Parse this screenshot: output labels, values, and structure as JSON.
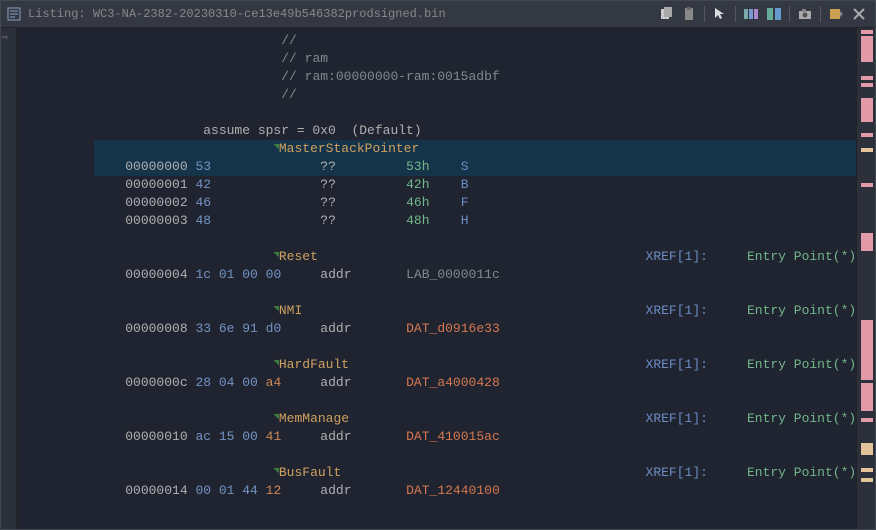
{
  "titlebar": {
    "prefix": "Listing: ",
    "filename": "WC3-NA-2382-20230310-ce13e49b546382prodsigned.bin"
  },
  "comments": {
    "c1": "//",
    "c2": "// ram",
    "c3": "// ram:00000000-ram:0015adbf",
    "c4": "//"
  },
  "assume": "assume spsr = 0x0  (Default)",
  "labels": {
    "msp": "MasterStackPointer",
    "reset": "Reset",
    "nmi": "NMI",
    "hard": "HardFault",
    "mem": "MemManage",
    "bus": "BusFault"
  },
  "rows": {
    "r0": {
      "addr": "00000000",
      "bytes": "53",
      "mnem": "??",
      "hex": "53h",
      "asc": "S"
    },
    "r1": {
      "addr": "00000001",
      "bytes": "42",
      "mnem": "??",
      "hex": "42h",
      "asc": "B"
    },
    "r2": {
      "addr": "00000002",
      "bytes": "46",
      "mnem": "??",
      "hex": "46h",
      "asc": "F"
    },
    "r3": {
      "addr": "00000003",
      "bytes": "48",
      "mnem": "??",
      "hex": "48h",
      "asc": "H"
    },
    "r4": {
      "addr": "00000004",
      "bytes": "1c 01 00 00",
      "mnem": "addr",
      "ref": "LAB_0000011c"
    },
    "r5": {
      "addr": "00000008",
      "bytes": "33 6e 91 d0",
      "mnem": "addr",
      "ref": "DAT_d0916e33"
    },
    "r6": {
      "addr": "0000000c",
      "bytes": "28 04 00 a4",
      "lastbyte": "a4",
      "mnem": "addr",
      "ref": "DAT_a4000428"
    },
    "r7": {
      "addr": "00000010",
      "bytes": "ac 15 00 41",
      "lastbyte": "41",
      "mnem": "addr",
      "ref": "DAT_410015ac"
    },
    "r8": {
      "addr": "00000014",
      "bytes": "00 01 44 12",
      "lastbyte": "12",
      "mnem": "addr",
      "ref": "DAT_12440100"
    }
  },
  "xref": "XREF[1]:",
  "epoint": "Entry Point(*)",
  "icons": {
    "listing": "listing-icon",
    "copy": "copy-icon",
    "paste": "paste-icon",
    "cursor": "cursor-icon",
    "fields1": "fields-icon",
    "fields2": "diff-icon",
    "snapshot": "camera-icon",
    "menu": "menu-icon",
    "close": "close-icon"
  }
}
